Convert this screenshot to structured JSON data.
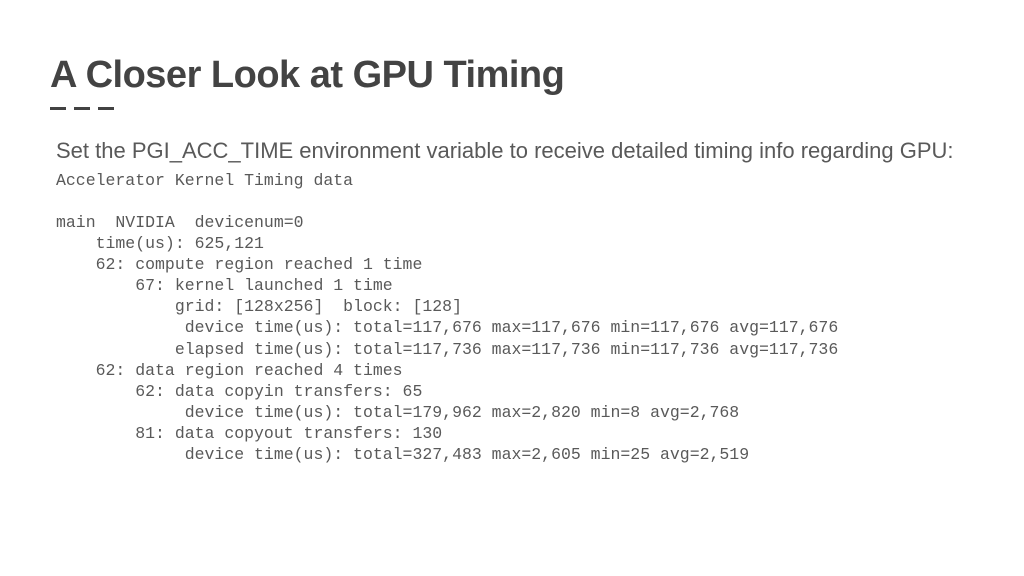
{
  "title": "A Closer Look at GPU Timing",
  "intro": "Set the PGI_ACC_TIME environment variable to receive detailed timing info regarding GPU:",
  "timing": {
    "header": "Accelerator Kernel Timing data",
    "main_line": "main  NVIDIA  devicenum=0",
    "time_us": "    time(us): 625,121",
    "compute_region": "    62: compute region reached 1 time",
    "kernel_launch": "        67: kernel launched 1 time",
    "grid_block": "            grid: [128x256]  block: [128]",
    "device_time1": "             device time(us): total=117,676 max=117,676 min=117,676 avg=117,676",
    "elapsed_time": "            elapsed time(us): total=117,736 max=117,736 min=117,736 avg=117,736",
    "data_region": "    62: data region reached 4 times",
    "copyin_hdr": "        62: data copyin transfers: 65",
    "copyin_time": "             device time(us): total=179,962 max=2,820 min=8 avg=2,768",
    "copyout_hdr": "        81: data copyout transfers: 130",
    "copyout_time": "             device time(us): total=327,483 max=2,605 min=25 avg=2,519"
  }
}
